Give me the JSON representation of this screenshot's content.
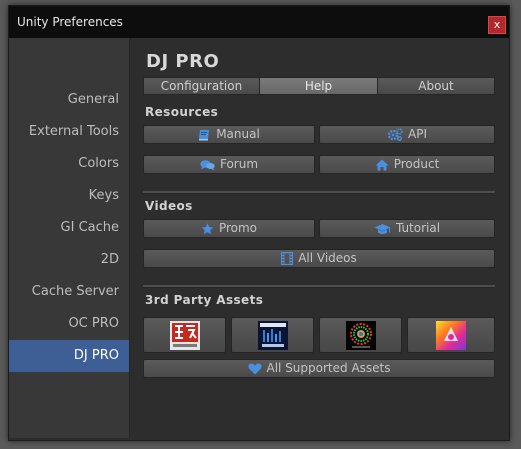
{
  "window": {
    "title": "Unity Preferences",
    "close_label": "x"
  },
  "sidebar": {
    "items": [
      {
        "label": "General"
      },
      {
        "label": "External Tools"
      },
      {
        "label": "Colors"
      },
      {
        "label": "Keys"
      },
      {
        "label": "GI Cache"
      },
      {
        "label": "2D"
      },
      {
        "label": "Cache Server"
      },
      {
        "label": "OC PRO"
      },
      {
        "label": "DJ PRO"
      }
    ],
    "selected": "DJ PRO"
  },
  "main": {
    "title": "DJ PRO",
    "tabs": [
      {
        "label": "Configuration"
      },
      {
        "label": "Help"
      },
      {
        "label": "About"
      }
    ],
    "active_tab": "Help",
    "resources": {
      "heading": "Resources",
      "manual": "Manual",
      "api": "API",
      "forum": "Forum",
      "product": "Product"
    },
    "videos": {
      "heading": "Videos",
      "promo": "Promo",
      "tutorial": "Tutorial",
      "all_videos": "All Videos"
    },
    "third_party": {
      "heading": "3rd Party Assets",
      "assets": [
        {
          "icon": "playmaker-logo-icon"
        },
        {
          "icon": "complete-sound-suite-icon"
        },
        {
          "icon": "audio-visualizer-icon"
        },
        {
          "icon": "rainbow-asset-icon"
        }
      ],
      "all_supported": "All Supported Assets"
    }
  },
  "colors": {
    "accent_selected": "#3e5f96",
    "icon_blue": "#4a8fe0",
    "close_red": "#b3282a"
  }
}
